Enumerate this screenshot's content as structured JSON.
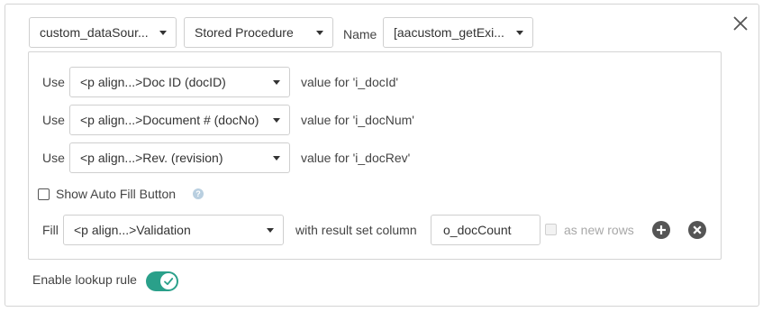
{
  "header": {
    "datasource_value": "custom_dataSour...",
    "type_value": "Stored Procedure",
    "name_label": "Name",
    "name_value": "[aacustom_getExi..."
  },
  "mappings": [
    {
      "use_label": "Use",
      "field_value": "<p align...>Doc ID (docID)",
      "param_text": "value for 'i_docId'"
    },
    {
      "use_label": "Use",
      "field_value": "<p align...>Document # (docNo)",
      "param_text": "value for 'i_docNum'"
    },
    {
      "use_label": "Use",
      "field_value": "<p align...>Rev. (revision)",
      "param_text": "value for 'i_docRev'"
    }
  ],
  "auto_fill": {
    "label": "Show Auto Fill Button",
    "checked": false,
    "help_icon": "?"
  },
  "fill": {
    "label": "Fill",
    "field_value": "<p align...>Validation",
    "result_label": "with result set column",
    "column_value": "o_docCount",
    "new_rows_label": "as new rows"
  },
  "lookup": {
    "label": "Enable lookup rule",
    "enabled": true
  },
  "colors": {
    "accent": "#2aa08a",
    "border": "#d4d4d4",
    "icon_dark": "#555555",
    "help": "#b9cfe0"
  }
}
